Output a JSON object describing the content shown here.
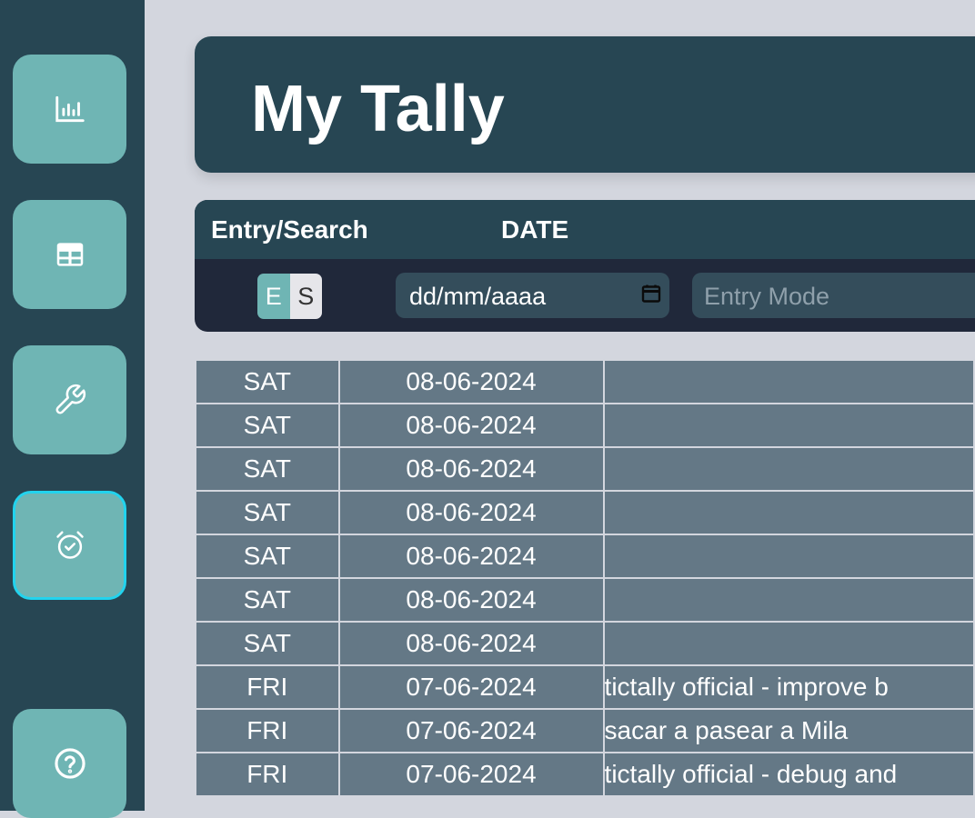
{
  "app": {
    "title": "My Tally"
  },
  "sidebar": {
    "items": [
      {
        "id": "stats",
        "icon": "chart-icon"
      },
      {
        "id": "table",
        "icon": "table-icon"
      },
      {
        "id": "settings",
        "icon": "wrench-icon"
      },
      {
        "id": "timer",
        "icon": "alarm-clock-icon",
        "active": true
      },
      {
        "id": "help",
        "icon": "help-icon"
      }
    ]
  },
  "panel": {
    "headers": {
      "entry_search": "Entry/Search",
      "date": "DATE"
    },
    "toggle": {
      "e_label": "E",
      "s_label": "S",
      "selected": "E"
    },
    "date_input": {
      "value": "dd/mm/aaaa"
    },
    "mode_input": {
      "placeholder": "Entry Mode"
    }
  },
  "rows": [
    {
      "day": "SAT",
      "date": "08-06-2024",
      "desc": ""
    },
    {
      "day": "SAT",
      "date": "08-06-2024",
      "desc": ""
    },
    {
      "day": "SAT",
      "date": "08-06-2024",
      "desc": ""
    },
    {
      "day": "SAT",
      "date": "08-06-2024",
      "desc": ""
    },
    {
      "day": "SAT",
      "date": "08-06-2024",
      "desc": ""
    },
    {
      "day": "SAT",
      "date": "08-06-2024",
      "desc": ""
    },
    {
      "day": "SAT",
      "date": "08-06-2024",
      "desc": ""
    },
    {
      "day": "FRI",
      "date": "07-06-2024",
      "desc": "tictally official - improve b"
    },
    {
      "day": "FRI",
      "date": "07-06-2024",
      "desc": "sacar a pasear a Mila"
    },
    {
      "day": "FRI",
      "date": "07-06-2024",
      "desc": "tictally official - debug and"
    }
  ],
  "colors": {
    "sidebar": "#274653",
    "button": "#6fb5b4",
    "active_border": "#22d3ee",
    "page_bg": "#d3d6de",
    "row_bg": "#647886"
  }
}
